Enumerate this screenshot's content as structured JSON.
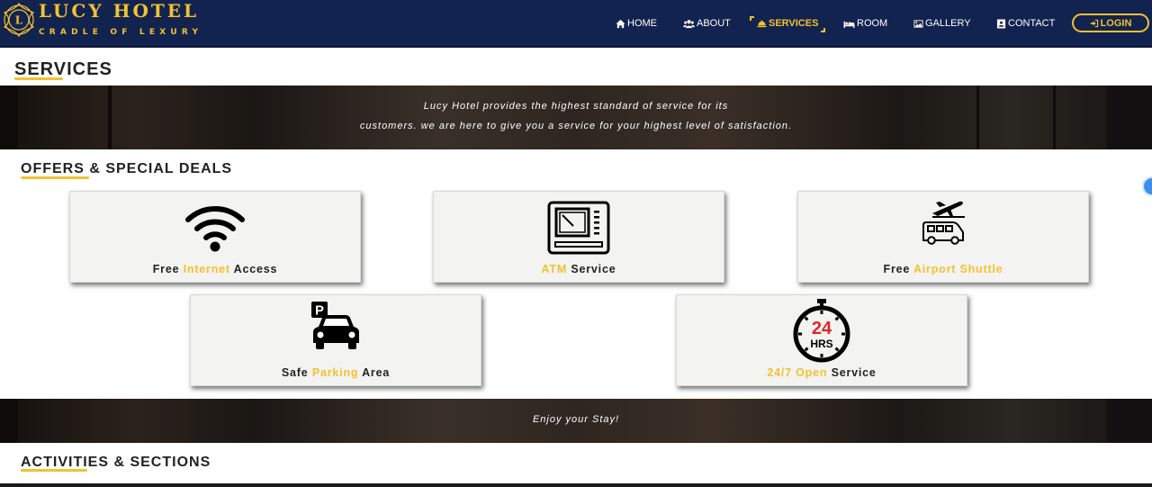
{
  "brand": {
    "emblem_letter": "L",
    "name": "LUCY HOTEL",
    "tagline": "CRADLE OF LEXURY"
  },
  "nav": {
    "items": [
      {
        "label": "HOME",
        "icon": "home-icon"
      },
      {
        "label": "ABOUT",
        "icon": "users-icon"
      },
      {
        "label": "SERVICES",
        "icon": "bell-icon",
        "active": true
      },
      {
        "label": "ROOM",
        "icon": "bed-icon"
      },
      {
        "label": "GALLERY",
        "icon": "image-icon"
      },
      {
        "label": "CONTACT",
        "icon": "contact-card-icon"
      }
    ],
    "login": {
      "label": "LOGIN",
      "icon": "login-icon"
    }
  },
  "page": {
    "title": "SERVICES"
  },
  "intro_banner": {
    "line1": "Lucy Hotel provides the highest standard of service for its",
    "line2": "customers. we are here to give you a service for your highest level of satisfaction."
  },
  "offers": {
    "title": "OFFERS & SPECIAL DEALS",
    "cards": [
      {
        "icon": "wifi-icon",
        "before": "Free ",
        "highlight": "Internet",
        "after": " Access"
      },
      {
        "icon": "atm-icon",
        "before": "",
        "highlight": "ATM",
        "after": " Service"
      },
      {
        "icon": "airport-shuttle-icon",
        "before": "Free ",
        "highlight": "Airport Shuttle",
        "after": ""
      },
      {
        "icon": "parking-icon",
        "before": "Safe ",
        "highlight": "Parking",
        "after": " Area"
      },
      {
        "icon": "24-hours-icon",
        "icon_text_top": "24",
        "icon_text_bottom": "HRS",
        "before": "",
        "highlight": "24/7 Open",
        "after": " Service"
      }
    ]
  },
  "stay_banner": {
    "text": "Enjoy your Stay!"
  },
  "activities": {
    "title": "ACTIVITIES & SECTIONS"
  },
  "colors": {
    "navy": "#12234f",
    "gold": "#f2c230",
    "card_bg": "#f3f3f1",
    "clock_red": "#e0262a"
  }
}
